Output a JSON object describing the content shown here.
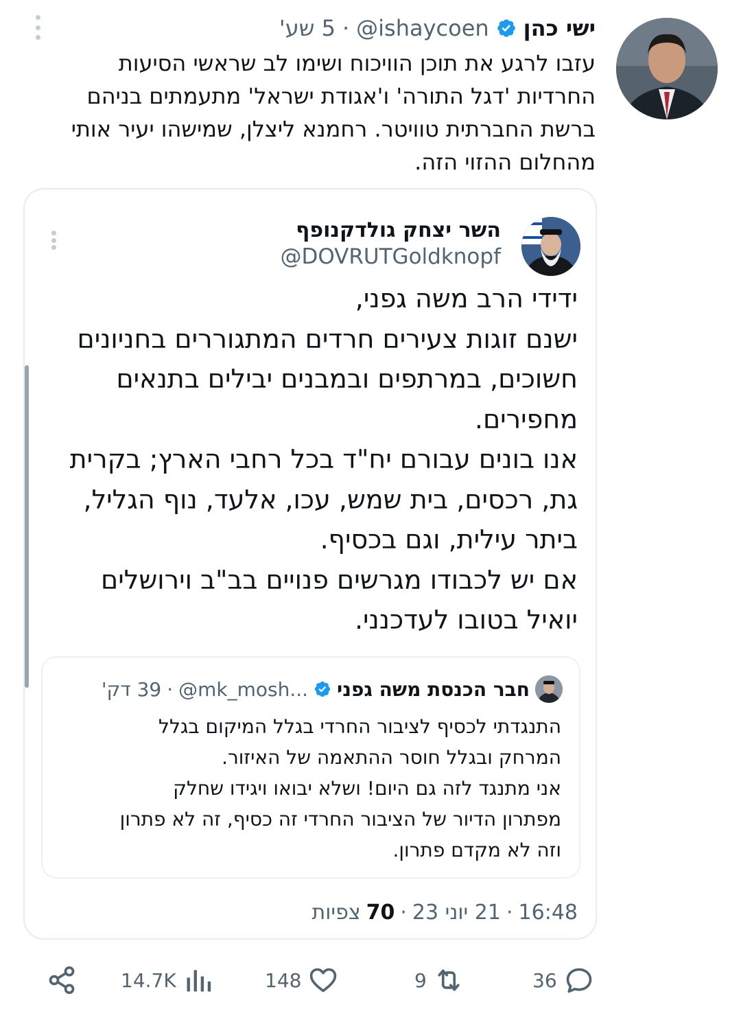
{
  "tweet": {
    "author_name": "ישי כהן",
    "handle": "@ishaycoen",
    "time": "5 שע'",
    "body_lines": [
      "עזבו לרגע את תוכן הוויכוח ושימו לב שראשי הסיעות",
      "החרדיות 'דגל התורה' ו'אגודת ישראל' מתעמתים בניהם",
      "ברשת החברתית טוויטר. רחמנא ליצלן, שמישהו יעיר אותי",
      "מהחלום ההזוי הזה."
    ]
  },
  "quote": {
    "author_name": "השר יצחק גולדקנופף",
    "handle": "@DOVRUTGoldknopf",
    "body_lines": [
      "ידידי הרב משה גפני,",
      "ישנם זוגות צעירים חרדים המתגוררים בחניונים",
      "חשוכים, במרתפים ובמבנים יבילים בתנאים",
      "מחפירים.",
      "אנו בונים עבורם יח\"ד בכל רחבי הארץ; בקרית",
      "גת, רכסים, בית שמש, עכו, אלעד, נוף הגליל,",
      "ביתר עילית, וגם בכסיף.",
      "אם יש לכבודו מגרשים פנויים בב\"ב וירושלים",
      "יואיל בטובו לעדכנני."
    ],
    "nested": {
      "author_name": "חבר הכנסת משה גפני",
      "handle": "@mk_mosh...",
      "time": "39 דק'",
      "body_lines": [
        "התנגדתי לכסיף לציבור החרדי בגלל המיקום בגלל",
        "המרחק ובגלל חוסר ההתאמה של האיזור.",
        "אני מתנגד לזה גם היום! ושלא יבואו ויגידו שחלק",
        "מפתרון הדיור של הציבור החרדי זה כסיף, זה לא פתרון",
        "וזה לא מקדם פתרון."
      ]
    },
    "meta": {
      "time": "16:48",
      "date": "21 יוני 23",
      "views_count": "70",
      "views_label": "צפיות"
    }
  },
  "actions": {
    "replies": "36",
    "retweets": "9",
    "likes": "148",
    "views": "14.7K"
  },
  "colors": {
    "verified": "#1d9bf0",
    "secondary_text": "#536471",
    "icon": "#536471"
  }
}
